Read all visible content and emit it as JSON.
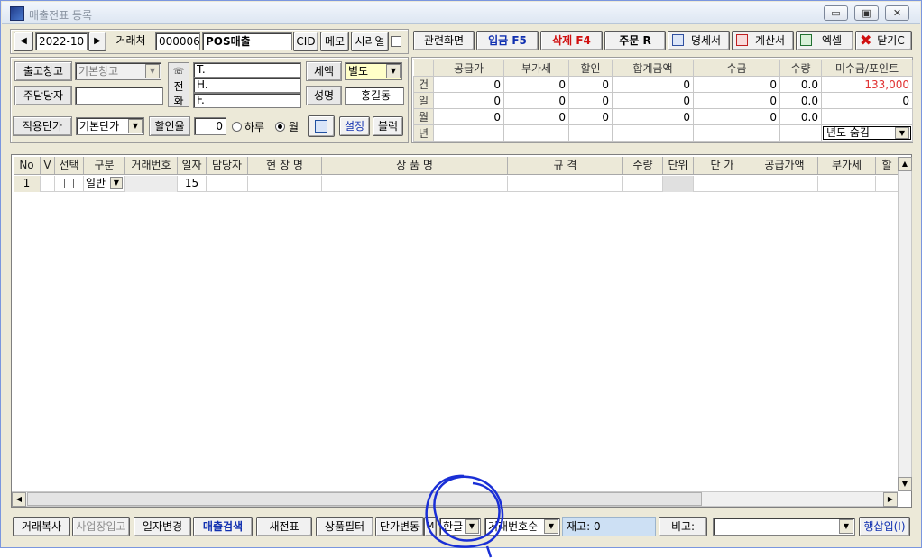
{
  "window": {
    "title": "매출전표 등록",
    "minimize": "▭",
    "maximize": "▣",
    "close": "✕"
  },
  "top": {
    "prev": "◀",
    "month": "2022-10",
    "next": "▶",
    "client_label": "거래처",
    "client_code": "000006",
    "client_name": "POS매출",
    "cid": "CID",
    "memo": "메모",
    "serial": "시리얼",
    "related": "관련화면",
    "deposit": "입금 F5",
    "delete": "삭제 F4",
    "order": "주문 R",
    "statement": "명세서",
    "invoice": "계산서",
    "excel": "엑셀",
    "close": "닫기C"
  },
  "form": {
    "warehouse_label": "출고창고",
    "warehouse_value": "기본창고",
    "manager_label": "주담당자",
    "manager_value": "",
    "phone_label": "전화",
    "tel": "T.",
    "hp": "H.",
    "fax": "F.",
    "tax_label": "세액",
    "tax_value": "별도",
    "name_label": "성명",
    "name_value": "홍길동",
    "price_label": "적용단가",
    "price_value": "기본단가",
    "discount_label": "할인율",
    "discount_value": "0",
    "radio_day": "하루",
    "radio_month": "월",
    "settings": "설정",
    "block": "블럭"
  },
  "summary": {
    "headers": [
      "공급가",
      "부가세",
      "할인",
      "합계금액",
      "수금",
      "수량",
      "미수금/포인트"
    ],
    "rows": [
      {
        "label": "건",
        "values": [
          "0",
          "0",
          "0",
          "0",
          "0",
          "0.0",
          "133,000"
        ]
      },
      {
        "label": "일",
        "values": [
          "0",
          "0",
          "0",
          "0",
          "0",
          "0.0",
          "0"
        ]
      },
      {
        "label": "월",
        "values": [
          "0",
          "0",
          "0",
          "0",
          "0",
          "0.0",
          ""
        ]
      },
      {
        "label": "년",
        "values": [
          "",
          "",
          "",
          "",
          "",
          "",
          ""
        ]
      }
    ],
    "year_hide": "년도 숨김"
  },
  "grid": {
    "headers": [
      "No",
      "V",
      "선택",
      "구분",
      "거래번호",
      "일자",
      "담당자",
      "현 장 명",
      "상 품 명",
      "규 격",
      "수량",
      "단위",
      "단 가",
      "공급가액",
      "부가세",
      "할"
    ],
    "row": {
      "no": "1",
      "kind": "일반",
      "day": "15"
    }
  },
  "bottom": {
    "copy": "거래복사",
    "business": "사업장입고",
    "date_change": "일자변경",
    "sales_search": "매출검색",
    "new_slip": "새전표",
    "product_filter": "상품필터",
    "price_change": "단가변동",
    "m": "M",
    "lang": "한글",
    "sort": "거래번호순",
    "stock": "재고: 0",
    "remark": "비고:",
    "insert": "행삽입(I)"
  }
}
